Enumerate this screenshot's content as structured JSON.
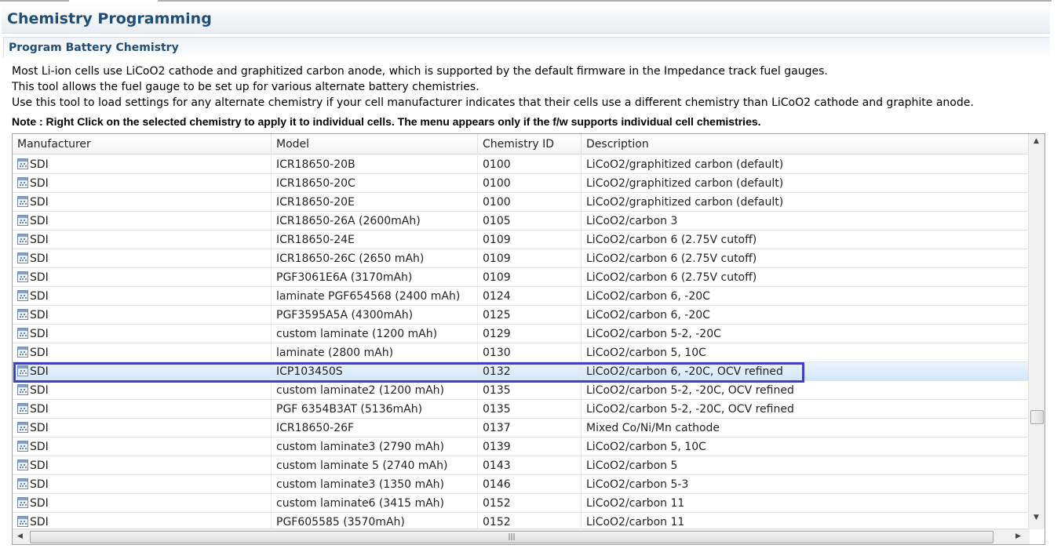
{
  "header": {
    "title": "Chemistry Programming"
  },
  "section": {
    "title": "Program Battery Chemistry"
  },
  "description": [
    "Most Li-ion cells use LiCoO2 cathode and graphitized carbon anode, which is supported by the default firmware in the Impedance track fuel gauges.",
    "This tool allows the fuel gauge to be set up for various alternate battery chemistries.",
    "Use this tool to load settings for any alternate chemistry if your cell manufacturer indicates that their cells use a different chemistry than LiCoO2 cathode and graphite anode."
  ],
  "note": "Note : Right Click on the selected chemistry to apply it to individual cells. The menu appears only if the f/w supports individual cell chemistries.",
  "table": {
    "columns": [
      "Manufacturer",
      "Model",
      "Chemistry ID",
      "Description"
    ],
    "selected_index": 11,
    "highlight_color": "#4040c0",
    "rows": [
      [
        "SDI",
        "ICR18650-20B",
        "0100",
        "LiCoO2/graphitized carbon (default)"
      ],
      [
        "SDI",
        "ICR18650-20C",
        "0100",
        "LiCoO2/graphitized carbon (default)"
      ],
      [
        "SDI",
        "ICR18650-20E",
        "0100",
        "LiCoO2/graphitized carbon (default)"
      ],
      [
        "SDI",
        "ICR18650-26A (2600mAh)",
        "0105",
        "LiCoO2/carbon 3"
      ],
      [
        "SDI",
        "ICR18650-24E",
        "0109",
        "LiCoO2/carbon 6 (2.75V cutoff)"
      ],
      [
        "SDI",
        "ICR18650-26C (2650 mAh)",
        "0109",
        "LiCoO2/carbon 6 (2.75V cutoff)"
      ],
      [
        "SDI",
        "PGF3061E6A (3170mAh)",
        "0109",
        "LiCoO2/carbon 6 (2.75V cutoff)"
      ],
      [
        "SDI",
        "laminate PGF654568 (2400 mAh)",
        "0124",
        "LiCoO2/carbon 6, -20C"
      ],
      [
        "SDI",
        "PGF3595A5A (4300mAh)",
        "0125",
        "LiCoO2/carbon 6, -20C"
      ],
      [
        "SDI",
        "custom laminate (1200 mAh)",
        "0129",
        "LiCoO2/carbon 5-2, -20C"
      ],
      [
        "SDI",
        "laminate (2800 mAh)",
        "0130",
        "LiCoO2/carbon 5, 10C"
      ],
      [
        "SDI",
        "ICP103450S",
        "0132",
        "LiCoO2/carbon 6, -20C, OCV refined"
      ],
      [
        "SDI",
        "custom laminate2 (1200 mAh)",
        "0135",
        "LiCoO2/carbon 5-2, -20C, OCV refined"
      ],
      [
        "SDI",
        "PGF 6354B3AT (5136mAh)",
        "0135",
        "LiCoO2/carbon 5-2, -20C, OCV refined"
      ],
      [
        "SDI",
        "ICR18650-26F",
        "0137",
        "Mixed Co/Ni/Mn cathode"
      ],
      [
        "SDI",
        "custom laminate3 (2790 mAh)",
        "0139",
        "LiCoO2/carbon 5, 10C"
      ],
      [
        "SDI",
        "custom laminate 5 (2740 mAh)",
        "0143",
        "LiCoO2/carbon 5"
      ],
      [
        "SDI",
        "custom laminate3 (1350 mAh)",
        "0146",
        "LiCoO2/carbon 5-3"
      ],
      [
        "SDI",
        "custom laminate6 (3415 mAh)",
        "0152",
        "LiCoO2/carbon 11"
      ],
      [
        "SDI",
        "PGF605585 (3570mAh)",
        "0152",
        "LiCoO2/carbon 11"
      ]
    ]
  }
}
